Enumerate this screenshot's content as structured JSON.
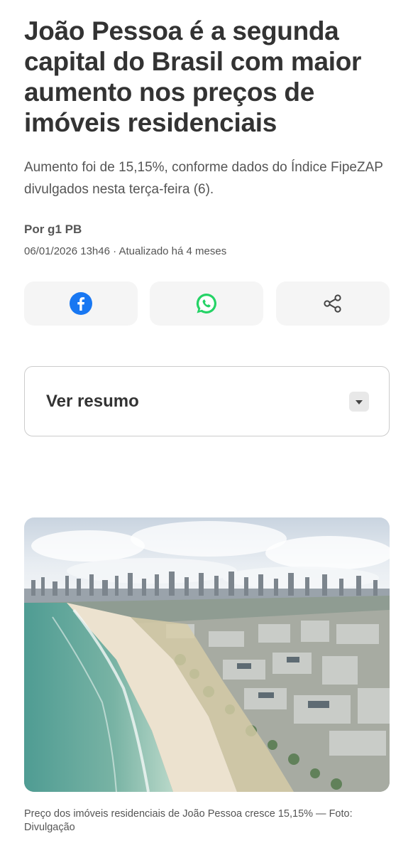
{
  "article": {
    "headline": "João Pessoa é a segunda capital do Brasil com maior aumento nos preços de imóveis residenciais",
    "subtitle": "Aumento foi de 15,15%, conforme dados do Índice FipeZAP divulgados nesta terça-feira (6).",
    "author": "Por g1 PB",
    "published": "06/01/2026 13h46",
    "separator": " · ",
    "updated": "Atualizado há 4 meses"
  },
  "share": {
    "buttons": [
      {
        "icon": "facebook-icon",
        "color": "#1877f2"
      },
      {
        "icon": "whatsapp-icon",
        "color": "#25d366"
      },
      {
        "icon": "share-icon",
        "color": "#444444"
      }
    ]
  },
  "summary": {
    "label": "Ver resumo",
    "icon": "chevron-down-icon"
  },
  "photo": {
    "caption": "Preço dos imóveis residenciais de João Pessoa cresce 15,15% — Foto: Divulgação"
  }
}
